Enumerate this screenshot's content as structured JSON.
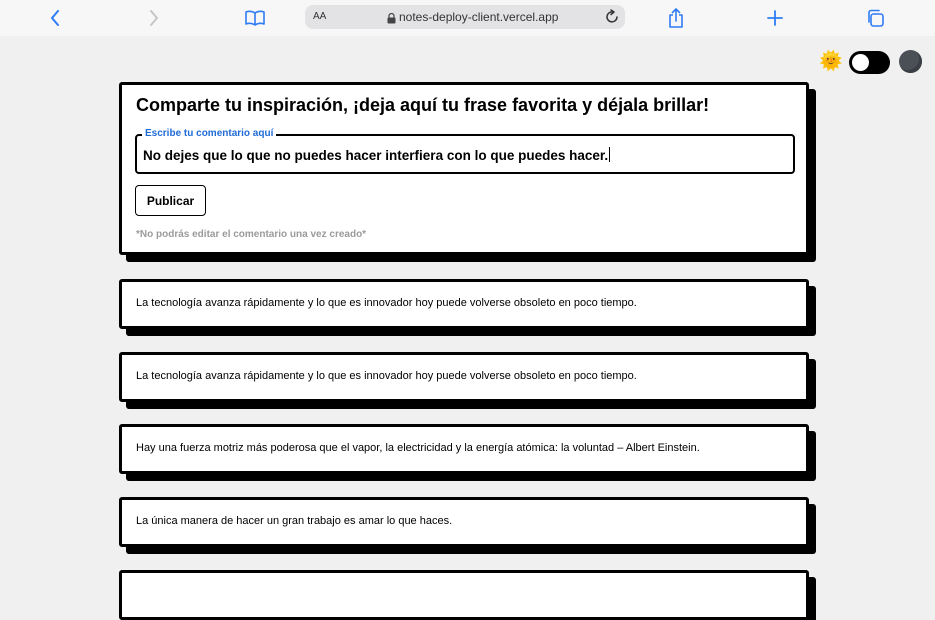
{
  "browser": {
    "url": "notes-deploy-client.vercel.app",
    "text_size_label": "AA"
  },
  "form": {
    "title": "Comparte tu inspiración, ¡deja aquí tu frase favorita y déjala brillar!",
    "field_label": "Escribe tu comentario aquí",
    "field_value": "No dejes que lo que no puedes hacer interfiera con lo que puedes hacer.",
    "button_label": "Publicar",
    "note": "*No podrás editar el comentario una vez creado*"
  },
  "comments": [
    "La tecnología avanza rápidamente y lo que es innovador hoy puede volverse obsoleto en poco tiempo.",
    "La tecnología avanza rápidamente y lo que es innovador hoy puede volverse obsoleto en poco tiempo.",
    "Hay una fuerza motriz más poderosa que el vapor, la electricidad y la energía atómica: la voluntad – Albert Einstein.",
    "La única manera de hacer un gran trabajo es amar lo que haces.",
    ""
  ],
  "theme": {
    "sun_glyph": "🌞",
    "dark_mode": false
  },
  "colors": {
    "accent": "#1f6bd6",
    "page_bg": "#f0f0f0"
  }
}
